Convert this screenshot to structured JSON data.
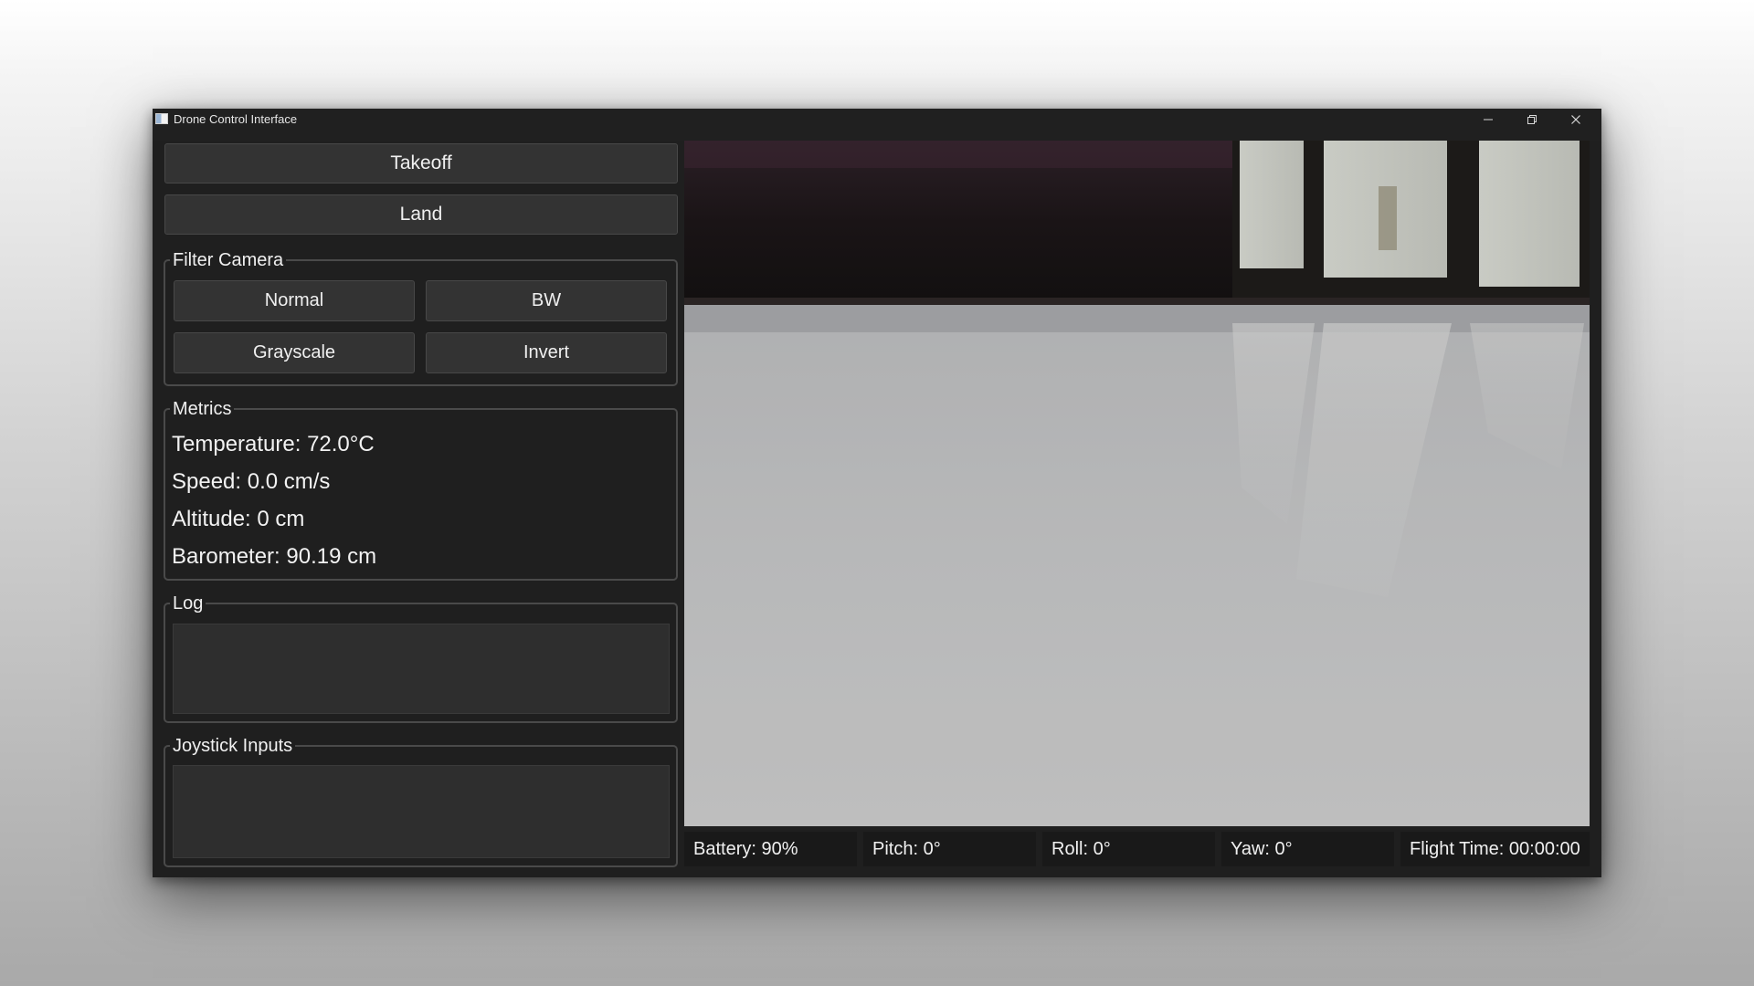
{
  "window": {
    "title": "Drone Control Interface",
    "controls": {
      "minimize": "minimize-icon",
      "maximize": "restore-icon",
      "close": "close-icon"
    }
  },
  "controls": {
    "takeoff_label": "Takeoff",
    "land_label": "Land"
  },
  "filter_camera": {
    "title": "Filter Camera",
    "buttons": [
      "Normal",
      "BW",
      "Grayscale",
      "Invert"
    ]
  },
  "metrics": {
    "title": "Metrics",
    "temperature": "Temperature: 72.0°C",
    "speed": "Speed: 0.0 cm/s",
    "altitude": "Altitude: 0 cm",
    "barometer": "Barometer: 90.19 cm"
  },
  "log": {
    "title": "Log",
    "content": ""
  },
  "joystick": {
    "title": "Joystick Inputs",
    "content": ""
  },
  "status_bar": {
    "battery": "Battery: 90%",
    "pitch": "Pitch: 0°",
    "roll": "Roll: 0°",
    "yaw": "Yaw: 0°",
    "flight_time": "Flight Time: 00:00:00"
  },
  "colors": {
    "window_bg": "#1f1f1f",
    "button_bg": "#333333",
    "text": "#f0f0f0",
    "group_border": "#4a4a4a",
    "status_bg": "#191919"
  }
}
